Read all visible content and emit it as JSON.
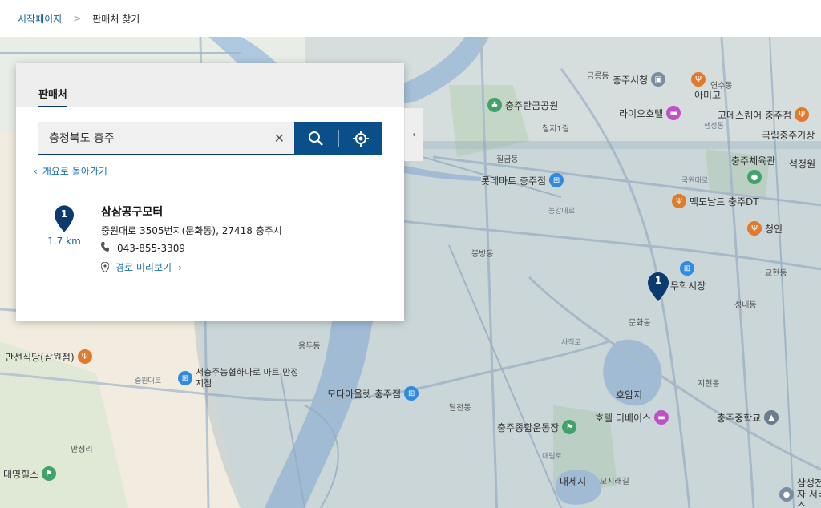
{
  "breadcrumb": {
    "home": "시작페이지",
    "separator": ">",
    "current": "판매처 찾기"
  },
  "panel": {
    "tab_label": "판매처",
    "search_value": "충청북도 충주",
    "back_label": "개요로 돌아가기",
    "result": {
      "pin_number": "1",
      "distance": "1.7 km",
      "name": "삼삼공구모터",
      "address": "중원대로 3505번지(문화동), 27418 충주시",
      "phone": "043-855-3309",
      "route_label": "경로 미리보기"
    }
  },
  "map": {
    "marker_number": "1",
    "colors": {
      "water": "#aec8df",
      "road_major": "#9fb4c8",
      "park": "#d4e4cb",
      "marker": "#0b3b6e",
      "overlay": "#7d9cb5"
    },
    "labels": {
      "stadium": "충주종합운동장",
      "hotel_devices": "호텔 더베이스",
      "school": "충주중학교",
      "pond": "호암지",
      "mart": "서충주농협하나로 마트 만정지점",
      "outlet": "모다아울렛 충주점",
      "restaurant": "만선식당(삼원점)",
      "daeyoung": "대영힐스",
      "lotte": "롯데마트 충주점",
      "mall": "충주탄금공원",
      "cityhall": "충주시청",
      "lahotel": "라이오호텔",
      "amigo": "아미고",
      "gomes": "고메스퀘어 충주점",
      "mcd": "맥도날드 충주DT",
      "stadium2": "충주체육관",
      "cheongin": "청인",
      "market": "무학시장",
      "samsung": "삼성전자 서비스",
      "mine": "국립충주기상",
      "seokjeong": "석정원",
      "daejeji": "대제지",
      "geumneungdong": "금릉동",
      "munhwadong": "문화동",
      "bongbang": "봉방동",
      "yongdudong": "용두동",
      "jihyeondong": "지현동",
      "yonsan": "용산동",
      "manjeong": "만정리",
      "dalcheon": "달천동",
      "seoindong": "성내동",
      "jeonggwan": "교현동",
      "chilgeum": "칠금동",
      "chilji": "칠지1길",
      "nonggang": "농강대로",
      "jungwondaero": "중원대로",
      "gukwon": "국원대로",
      "daerim": "대림로",
      "sajik": "사직로",
      "moshi": "모시래길",
      "yeonsu": "연수동",
      "haengjeong": "행정동"
    }
  }
}
